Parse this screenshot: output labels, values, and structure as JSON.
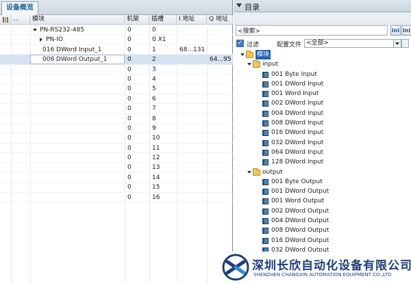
{
  "left": {
    "tab_title": "设备概览",
    "columns": [
      "",
      "",
      "模块",
      "机架",
      "插槽",
      "I 地址",
      "Q 地址"
    ],
    "rows": [
      {
        "module": "PN-RS232-485",
        "rack": "0",
        "slot": "0",
        "i": "",
        "q": "",
        "expand": "down",
        "indent": 1
      },
      {
        "module": "PN-IO",
        "rack": "0",
        "slot": "0 X1",
        "i": "",
        "q": "",
        "expand": "right",
        "indent": 2
      },
      {
        "module": "016 DWord Input_1",
        "rack": "0",
        "slot": "1",
        "i": "68...131",
        "q": "",
        "indent": 0
      },
      {
        "module": "008 DWord Output_1",
        "rack": "0",
        "slot": "2",
        "i": "",
        "q": "64...95",
        "indent": 0,
        "selected": true
      },
      {
        "module": "",
        "rack": "0",
        "slot": "3"
      },
      {
        "module": "",
        "rack": "0",
        "slot": "4"
      },
      {
        "module": "",
        "rack": "0",
        "slot": "5"
      },
      {
        "module": "",
        "rack": "0",
        "slot": "6"
      },
      {
        "module": "",
        "rack": "0",
        "slot": "7"
      },
      {
        "module": "",
        "rack": "0",
        "slot": "8"
      },
      {
        "module": "",
        "rack": "0",
        "slot": "9"
      },
      {
        "module": "",
        "rack": "0",
        "slot": "10"
      },
      {
        "module": "",
        "rack": "0",
        "slot": "11"
      },
      {
        "module": "",
        "rack": "0",
        "slot": "12"
      },
      {
        "module": "",
        "rack": "0",
        "slot": "13"
      },
      {
        "module": "",
        "rack": "0",
        "slot": "14"
      },
      {
        "module": "",
        "rack": "0",
        "slot": "15"
      },
      {
        "module": "",
        "rack": "0",
        "slot": "16"
      }
    ]
  },
  "catalog": {
    "title": "目录",
    "search_placeholder": "<搜索>",
    "btn1": "ini",
    "btn2": "ini",
    "filter_label": "过滤",
    "filter_checked": true,
    "profile_label": "配置文件",
    "profile_value": "<全部>",
    "tree": [
      {
        "label": "模块",
        "type": "folder",
        "level": 0,
        "expanded": true,
        "highlight": true
      },
      {
        "label": "input",
        "type": "folder",
        "level": 1,
        "expanded": true
      },
      {
        "label": "001 Byte Input",
        "type": "module",
        "level": 2
      },
      {
        "label": "001 DWord Input",
        "type": "module",
        "level": 2
      },
      {
        "label": "001 Word Input",
        "type": "module",
        "level": 2
      },
      {
        "label": "002 DWord Input",
        "type": "module",
        "level": 2
      },
      {
        "label": "004 DWord Input",
        "type": "module",
        "level": 2
      },
      {
        "label": "008 DWord Input",
        "type": "module",
        "level": 2
      },
      {
        "label": "016 DWord Input",
        "type": "module",
        "level": 2
      },
      {
        "label": "032 DWord Input",
        "type": "module",
        "level": 2
      },
      {
        "label": "064 DWord Input",
        "type": "module",
        "level": 2
      },
      {
        "label": "128 DWord Input",
        "type": "module",
        "level": 2
      },
      {
        "label": "output",
        "type": "folder",
        "level": 1,
        "expanded": true
      },
      {
        "label": "001 Byte Output",
        "type": "module",
        "level": 2
      },
      {
        "label": "001 DWord Output",
        "type": "module",
        "level": 2
      },
      {
        "label": "001 Word Output",
        "type": "module",
        "level": 2
      },
      {
        "label": "002 DWord Output",
        "type": "module",
        "level": 2
      },
      {
        "label": "004 DWord Output",
        "type": "module",
        "level": 2
      },
      {
        "label": "008 DWord Output",
        "type": "module",
        "level": 2
      },
      {
        "label": "016 DWord Output",
        "type": "module",
        "level": 2
      },
      {
        "label": "032 DWord Output",
        "type": "module",
        "level": 2
      }
    ]
  },
  "watermark": {
    "company_cn": "深圳长欣自动化设备有限公司",
    "company_en": "SHENZHEN CHANGXIN AUTOMATION EQUIPMENT CO.,LTD"
  },
  "colors": {
    "accent": "#1e63b8",
    "brand": "#1c3d78",
    "folder": "#f1c85a",
    "selected_row": "#d5e2f0"
  }
}
